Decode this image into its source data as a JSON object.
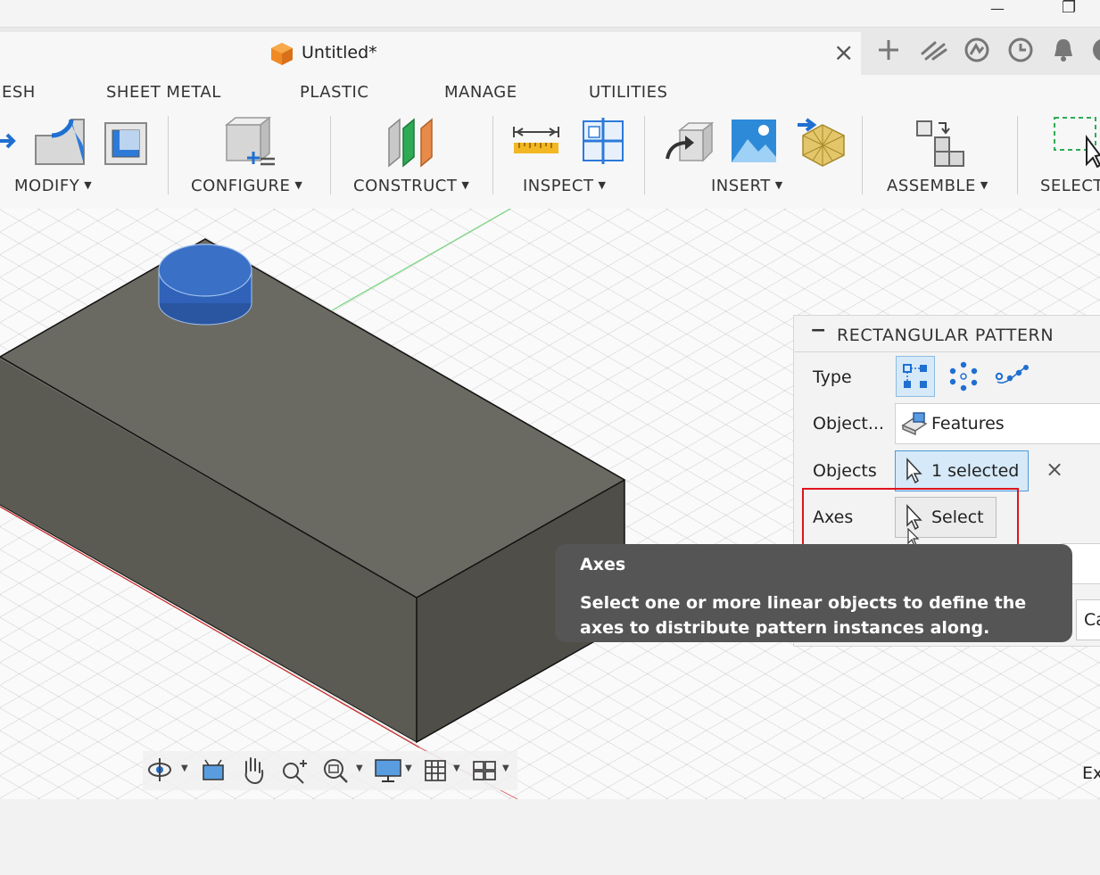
{
  "window": {
    "minimize_glyph": "—",
    "restore_glyph": "❐"
  },
  "document_tab": {
    "title": "Untitled*",
    "close_glyph": "×"
  },
  "header_icons": [
    "plus-icon",
    "extensions-icon",
    "online-status-icon",
    "job-status-icon",
    "notifications-icon",
    "help-icon"
  ],
  "ribbon_tabs": [
    "ESH",
    "SHEET METAL",
    "PLASTIC",
    "MANAGE",
    "UTILITIES"
  ],
  "ribbon_groups": {
    "modify": "MODIFY",
    "configure": "CONFIGURE",
    "construct": "CONSTRUCT",
    "inspect": "INSPECT",
    "insert": "INSERT",
    "assemble": "ASSEMBLE",
    "select": "SELECT"
  },
  "panel": {
    "title": "RECTANGULAR PATTERN",
    "collapse_glyph": "−",
    "type_label": "Type",
    "object_type_label": "Object...",
    "object_type_value": "Features",
    "objects_label": "Objects",
    "objects_value": "1 selected",
    "objects_clear_glyph": "×",
    "axes_label": "Axes",
    "axes_value": "Select",
    "cancel_partial": "Ca"
  },
  "tooltip": {
    "title": "Axes",
    "body": "Select one or more linear objects to define the axes to distribute pattern instances along."
  },
  "viewport_partial_text": "Ex",
  "colors": {
    "accent_blue": "#1f6fd1",
    "selected_button_bg": "#d6e9f8",
    "highlight_red": "#e0141e",
    "tooltip_bg": "#555555",
    "box_top": "#6b6a62",
    "box_front": "#5b5a53",
    "box_side": "#4f4e48",
    "cylinder_blue": "#2f62b8"
  }
}
